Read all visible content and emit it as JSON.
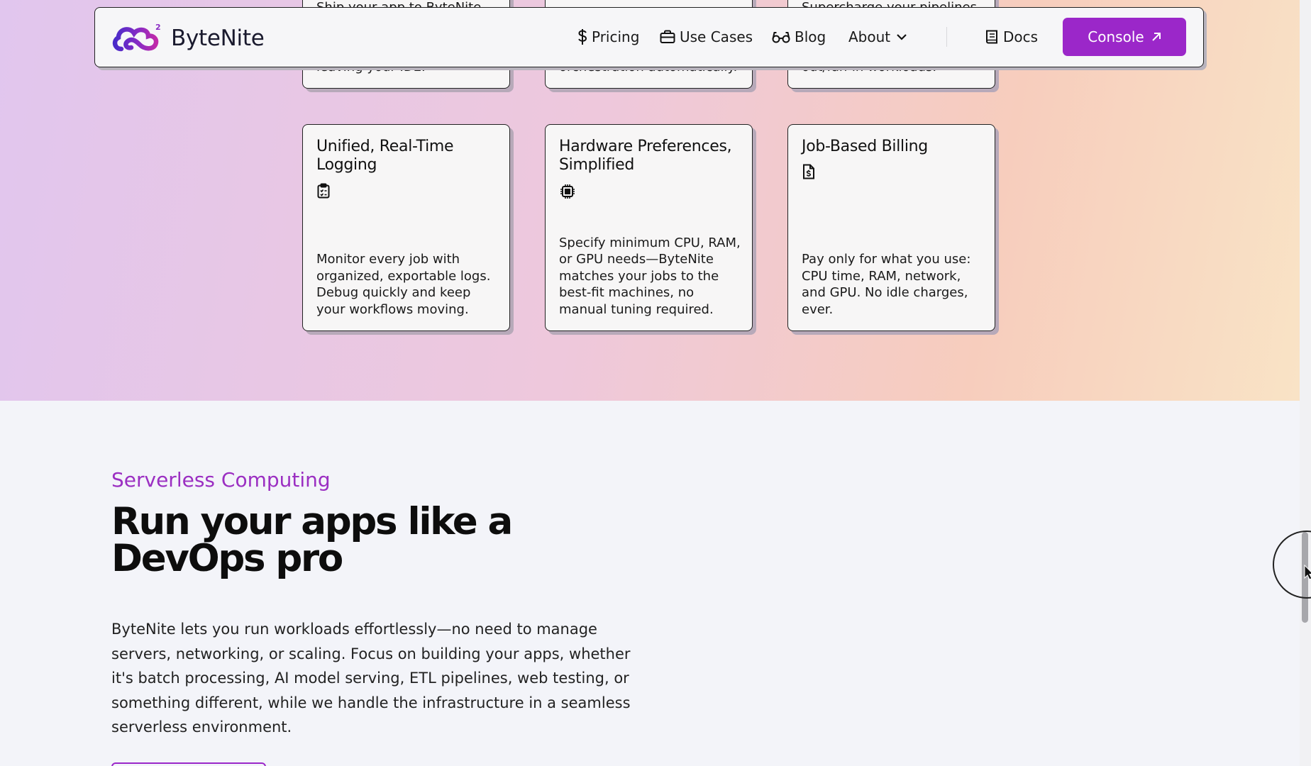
{
  "nav": {
    "brand": "ByteNite",
    "items": [
      {
        "label": "Pricing",
        "icon": "dollar-icon"
      },
      {
        "label": "Use Cases",
        "icon": "briefcase-icon"
      },
      {
        "label": "Blog",
        "icon": "glasses-icon"
      },
      {
        "label": "About",
        "icon": "chevron-down-icon"
      }
    ],
    "docs": "Docs",
    "console": "Console"
  },
  "cards_top": [
    {
      "text_top": "Ship your app to ByteNite",
      "text_bottom": "leaving your IDE."
    },
    {
      "text_top": "",
      "text_bottom": "orchestration automatically."
    },
    {
      "text_top": "Supercharge your pipelines",
      "text_bottom": "out/fan-in workloads."
    }
  ],
  "cards": [
    {
      "title": "Unified, Real-Time Logging",
      "icon": "clipboard-list-icon",
      "desc": "Monitor every job with organized, exportable logs. Debug quickly and keep your workflows moving."
    },
    {
      "title": "Hardware Preferences, Simplified",
      "icon": "cpu-chip-icon",
      "desc": "Specify minimum CPU, RAM, or GPU needs—ByteNite matches your jobs to the best-fit machines, no manual tuning required."
    },
    {
      "title": "Job-Based Billing",
      "icon": "invoice-dollar-icon",
      "desc": "Pay only for what you use: CPU time, RAM, network, and GPU. No idle charges, ever."
    }
  ],
  "section": {
    "eyebrow": "Serverless Computing",
    "heading": "Run your apps like a DevOps pro",
    "body": "ByteNite lets you run workloads effortlessly—no need to manage servers, networking, or scaling. Focus on building your apps, whether it's batch processing, AI model serving, ETL pipelines, web testing, or something different, while we handle the infrastructure in a seamless serverless environment."
  },
  "colors": {
    "accent": "#9b27c9",
    "eyebrow": "#9b2fc2"
  }
}
